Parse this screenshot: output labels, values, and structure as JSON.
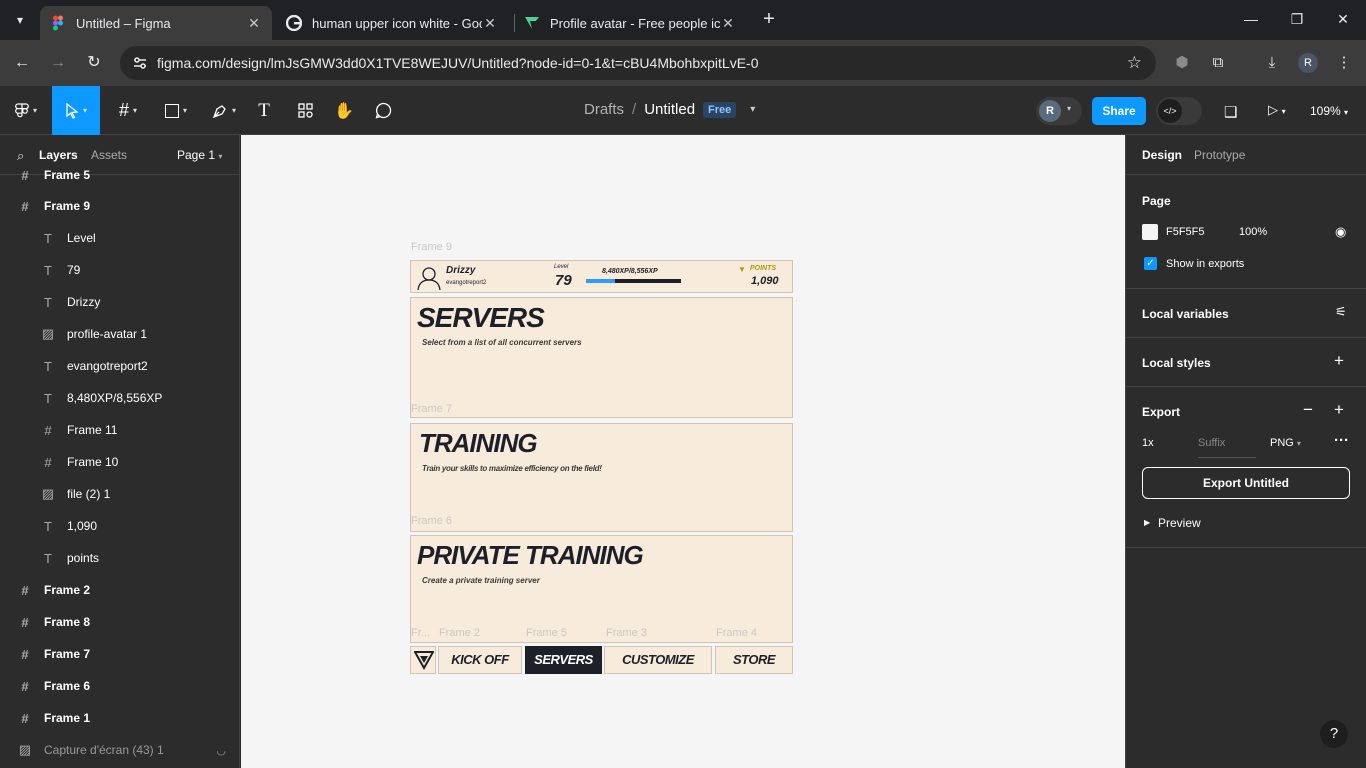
{
  "browser": {
    "tabs": [
      {
        "title": "Untitled – Figma"
      },
      {
        "title": "human upper icon white - Goo"
      },
      {
        "title": "Profile avatar - Free people icon"
      }
    ],
    "url": "figma.com/design/lmJsGMW3dd0X1TVE8WEJUV/Untitled?node-id=0-1&t=cBU4MbohbxpitLvE-0",
    "profile_initial": "R"
  },
  "toolbar": {
    "crumb_drafts": "Drafts",
    "crumb_sep": "/",
    "file_title": "Untitled",
    "plan_badge": "Free",
    "user_initial": "R",
    "share_label": "Share",
    "zoom": "109%"
  },
  "left_panel": {
    "tab_layers": "Layers",
    "tab_assets": "Assets",
    "page_label": "Page 1",
    "layers": [
      {
        "label": "Frame 5",
        "kind": "frame"
      },
      {
        "label": "Frame 9",
        "kind": "frame"
      },
      {
        "label": "Level",
        "kind": "text"
      },
      {
        "label": "79",
        "kind": "text"
      },
      {
        "label": "Drizzy",
        "kind": "text"
      },
      {
        "label": "profile-avatar 1",
        "kind": "image"
      },
      {
        "label": "evangotreport2",
        "kind": "text"
      },
      {
        "label": "8,480XP/8,556XP",
        "kind": "text"
      },
      {
        "label": "Frame 11",
        "kind": "frame"
      },
      {
        "label": "Frame 10",
        "kind": "frame"
      },
      {
        "label": "file (2) 1",
        "kind": "image"
      },
      {
        "label": "1,090",
        "kind": "text"
      },
      {
        "label": "points",
        "kind": "text"
      },
      {
        "label": "Frame 2",
        "kind": "frame"
      },
      {
        "label": "Frame 8",
        "kind": "frame"
      },
      {
        "label": "Frame 7",
        "kind": "frame"
      },
      {
        "label": "Frame 6",
        "kind": "frame"
      },
      {
        "label": "Frame 1",
        "kind": "frame"
      },
      {
        "label": "Capture d'écran (43) 1",
        "kind": "hidden"
      }
    ]
  },
  "canvas": {
    "frame_labels": {
      "frame9": "Frame 9",
      "frame7": "Frame 7",
      "frame6": "Frame 6",
      "frame_trunc": "Fr...",
      "frame2": "Frame 2",
      "frame5": "Frame 5",
      "frame3": "Frame 3",
      "frame4": "Frame 4"
    },
    "header": {
      "username": "Drizzy",
      "handle": "evangotreport2",
      "level_label": "Level",
      "level_value": "79",
      "xp": "8,480XP/8,556XP",
      "xp_progress": 0.3,
      "points_label": "POINTS",
      "points_value": "1,090"
    },
    "sections": [
      {
        "title": "SERVERS",
        "subtitle": "Select from a list of all concurrent servers"
      },
      {
        "title": "TRAINING",
        "subtitle": "Train your skills to maximize efficiency on the field!"
      },
      {
        "title": "PRIVATE TRAINING",
        "subtitle": "Create a private training server"
      }
    ],
    "nav": [
      "KICK OFF",
      "SERVERS",
      "CUSTOMIZE",
      "STORE"
    ],
    "colors": {
      "card_bg": "#f7ebdb",
      "dark": "#1e2029",
      "xp_bar": "#2f9bff"
    }
  },
  "right_panel": {
    "tab_design": "Design",
    "tab_prototype": "Prototype",
    "page_title": "Page",
    "page_color": "F5F5F5",
    "page_opacity": "100%",
    "show_in_exports": "Show in exports",
    "local_variables": "Local variables",
    "local_styles": "Local styles",
    "export_title": "Export",
    "export_scale": "1x",
    "export_suffix_placeholder": "Suffix",
    "export_format": "PNG",
    "export_button": "Export Untitled",
    "preview": "Preview"
  }
}
